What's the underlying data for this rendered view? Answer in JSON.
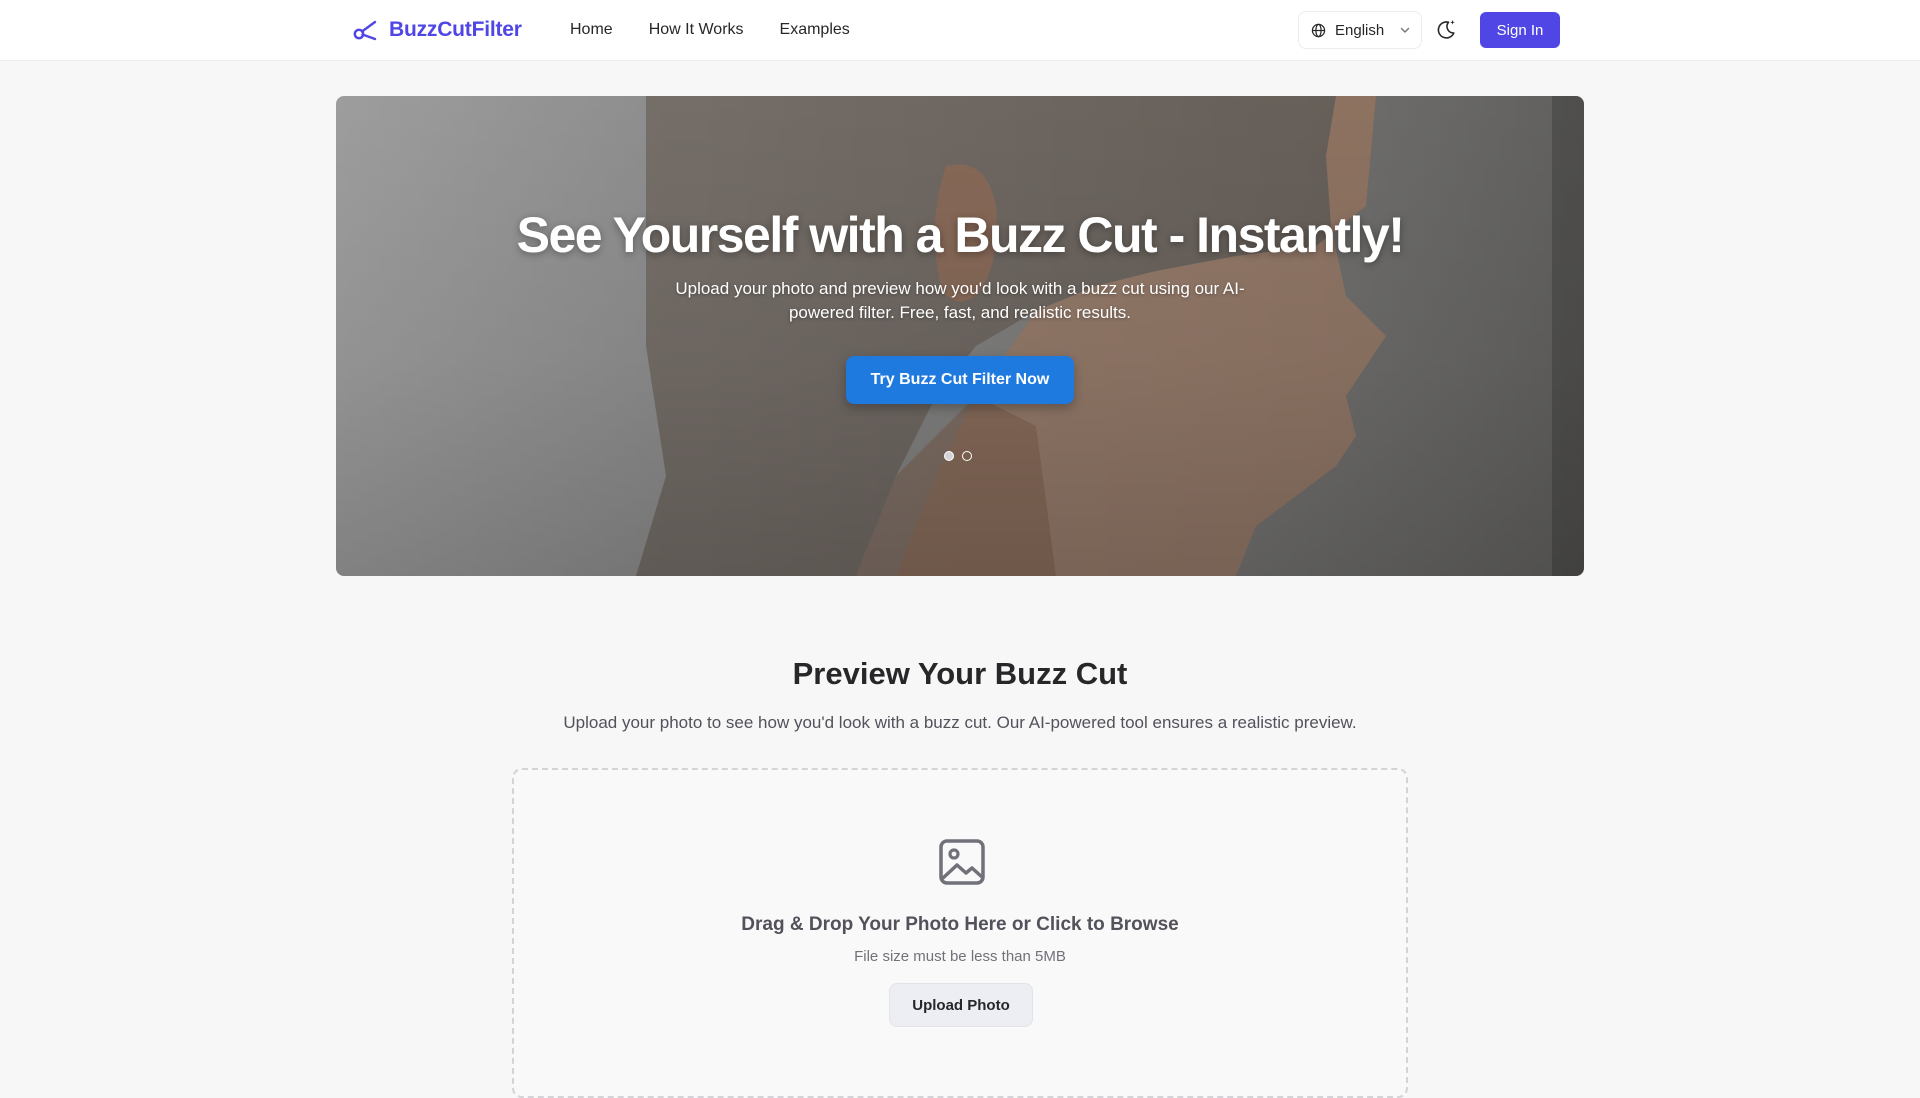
{
  "brand": {
    "name": "BuzzCutFilter",
    "color": "#4f46e5"
  },
  "nav": {
    "items": [
      "Home",
      "How It Works",
      "Examples"
    ]
  },
  "language": {
    "selected": "English"
  },
  "auth": {
    "sign_in_label": "Sign In"
  },
  "hero": {
    "title": "See Yourself with a Buzz Cut - Instantly!",
    "subtitle": "Upload your photo and preview how you'd look with a buzz cut using our AI-powered filter. Free, fast, and realistic results.",
    "cta_label": "Try Buzz Cut Filter Now",
    "cta_color": "#1f7ae0",
    "slides": {
      "count": 2,
      "active_index": 0
    }
  },
  "preview": {
    "title": "Preview Your Buzz Cut",
    "subtitle": "Upload your photo to see how you'd look with a buzz cut. Our AI-powered tool ensures a realistic preview.",
    "dropzone": {
      "title": "Drag & Drop Your Photo Here or Click to Browse",
      "note": "File size must be less than 5MB",
      "button_label": "Upload Photo"
    }
  },
  "icons": [
    "scissors-logo-icon",
    "globe-icon",
    "chevron-down-icon",
    "moon-sparkle-icon",
    "image-icon"
  ]
}
